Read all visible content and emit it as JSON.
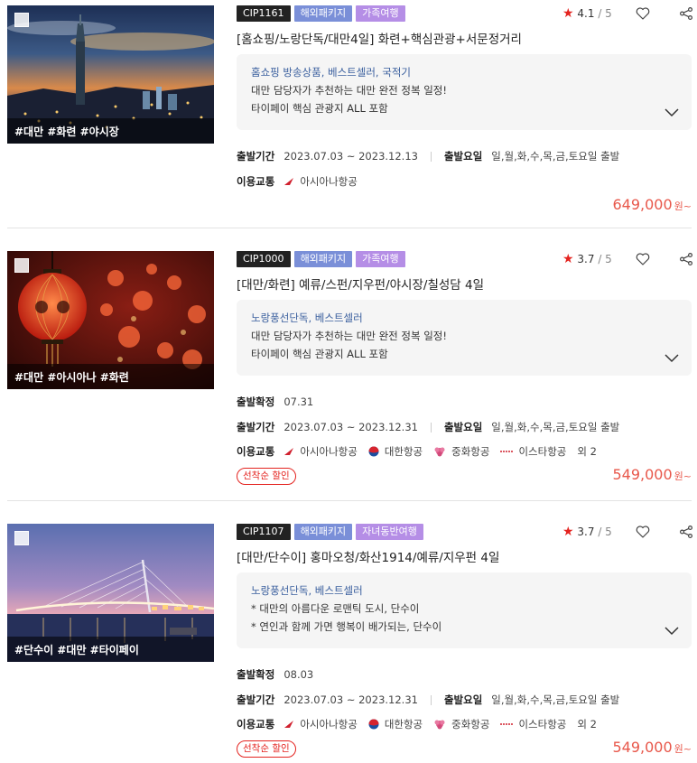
{
  "products": [
    {
      "code": "CIP1161",
      "package_type": "해외패키지",
      "theme": "가족여행",
      "rating": "4.1",
      "rating_max": "/ 5",
      "title": "[홈쇼핑/노랑단독/대만4일] 화련+핵심관광+서문정거리",
      "highlight": "홈쇼핑 방송상품, 베스트셀러, 국적기",
      "desc_lines": [
        "대만 담당자가 추천하는 대만 완전 정복 일정!",
        "타이페이 핵심 관광지 ALL 포함"
      ],
      "hashtags": "#대만 #화련 #야시장",
      "departure_confirm_label": "",
      "departure_confirm": "",
      "period_label": "출발기간",
      "period": "2023.07.03 ~ 2023.12.13",
      "days_label": "출발요일",
      "days": "일,월,화,수,목,금,토요일 출발",
      "transport_label": "이용교통",
      "airlines": [
        "아시아나항공"
      ],
      "airlines_more": "",
      "promo": "",
      "price": "649,000",
      "price_unit": "원~"
    },
    {
      "code": "CIP1000",
      "package_type": "해외패키지",
      "theme": "가족여행",
      "rating": "3.7",
      "rating_max": "/ 5",
      "title": "[대만/화련] 예류/스펀/지우펀/야시장/칠성담 4일",
      "highlight": "노랑풍선단독, 베스트셀러",
      "desc_lines": [
        "대만 담당자가 추천하는 대만 완전 정복 일정!",
        "타이페이 핵심 관광지 ALL 포함"
      ],
      "hashtags": "#대만 #아시아나 #화련",
      "departure_confirm_label": "출발확정",
      "departure_confirm": "07.31",
      "period_label": "출발기간",
      "period": "2023.07.03 ~ 2023.12.31",
      "days_label": "출발요일",
      "days": "일,월,화,수,목,금,토요일 출발",
      "transport_label": "이용교통",
      "airlines": [
        "아시아나항공",
        "대한항공",
        "중화항공",
        "이스타항공"
      ],
      "airlines_more": "외 2",
      "promo": "선착순 할인",
      "price": "549,000",
      "price_unit": "원~"
    },
    {
      "code": "CIP1107",
      "package_type": "해외패키지",
      "theme": "자녀동반여행",
      "rating": "3.7",
      "rating_max": "/ 5",
      "title": "[대만/단수이] 홍마오청/화산1914/예류/지우펀 4일",
      "highlight": "노랑풍선단독, 베스트셀러",
      "desc_lines": [
        "* 대만의 아름다운 로맨틱 도시, 단수이",
        "* 연인과 함께 가면 행복이 배가되는, 단수이"
      ],
      "hashtags": "#단수이 #대만 #타이페이",
      "departure_confirm_label": "출발확정",
      "departure_confirm": "08.03",
      "period_label": "출발기간",
      "period": "2023.07.03 ~ 2023.12.31",
      "days_label": "출발요일",
      "days": "일,월,화,수,목,금,토요일 출발",
      "transport_label": "이용교통",
      "airlines": [
        "아시아나항공",
        "대한항공",
        "중화항공",
        "이스타항공"
      ],
      "airlines_more": "외 2",
      "promo": "선착순 할인",
      "price": "549,000",
      "price_unit": "원~"
    }
  ],
  "icons": {
    "rating": "star-icon",
    "wishlist": "heart-icon",
    "share": "share-icon",
    "expand": "chevron-down-icon"
  },
  "colors": {
    "price": "#e8574a",
    "star": "#e4231f",
    "highlight": "#3a5f9e",
    "badge_code": "#222222",
    "badge_package": "#7a8fd8",
    "badge_theme": "#b58ee6"
  }
}
